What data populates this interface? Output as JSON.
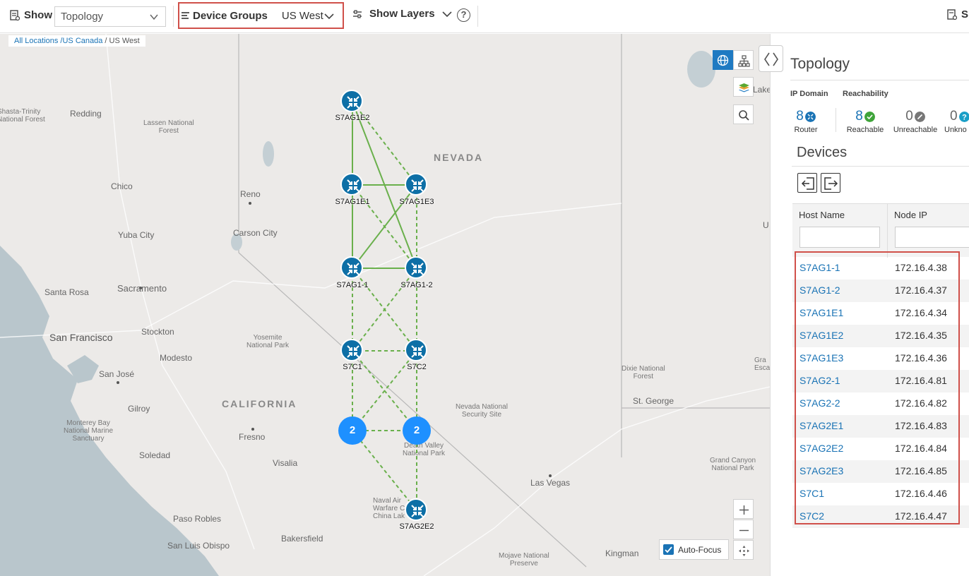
{
  "toolbar": {
    "show_label": "Show",
    "show_value": "Topology",
    "device_groups_label": "Device Groups",
    "device_groups_value": "US West",
    "show_layers_label": "Show Layers",
    "help_glyph": "?",
    "right_label": "S"
  },
  "map": {
    "breadcrumb": {
      "part1": "All Locations",
      "part2": " /US Canada",
      "part3": " / US West"
    },
    "places": {
      "shasta": "Shasta-Trinity\nNational Forest",
      "redding": "Redding",
      "lassen": "Lassen National\nForest",
      "chico": "Chico",
      "reno": "Reno",
      "carson": "Carson City",
      "yuba": "Yuba City",
      "sacramento": "Sacramento",
      "santa_rosa": "Santa Rosa",
      "stockton": "Stockton",
      "san_francisco": "San Francisco",
      "yosemite": "Yosemite\nNational Park",
      "modesto": "Modesto",
      "san_jose": "San José",
      "california": "CALIFORNIA",
      "gilroy": "Gilroy",
      "monterey": "Monterey Bay\nNational Marine\nSanctuary",
      "fresno": "Fresno",
      "soledad": "Soledad",
      "visalia": "Visalia",
      "paso_robles": "Paso Robles",
      "bakersfield": "Bakersfield",
      "san_luis": "San Luis Obispo",
      "nevada": "NEVADA",
      "nevada_security": "Nevada National\nSecurity Site",
      "death_valley": "Death Valley\nNational Park",
      "naval_air": "Naval Air\nWarfare Ce\nChina Lak",
      "las_vegas": "Las Vegas",
      "kingman": "Kingman",
      "mojave": "Mojave National\nPreserve",
      "dixie": "Dixie National\nForest",
      "st_george": "St. George",
      "grand_canyon": "Grand Canyon\nNational Park",
      "lake": "Lake",
      "u": "U",
      "gra": "Gra\nEsca"
    },
    "nodes": {
      "s7ag1e2": "S7AG1E2",
      "s7ag1e1": "S7AG1E1",
      "s7ag1e3": "S7AG1E3",
      "s7ag1_1": "S7AG1-1",
      "s7ag1_2": "S7AG1-2",
      "s7c1": "S7C1",
      "s7c2": "S7C2",
      "s7ag2e2": "S7AG2E2"
    },
    "clusters": {
      "left": "2",
      "right": "2"
    },
    "autofocus_label": "Auto-Focus",
    "autofocus_checked": true
  },
  "panel": {
    "title": "Topology",
    "ip_domain_label": "IP Domain",
    "reachability_label": "Reachability",
    "stats": [
      {
        "count": "8",
        "label": "Router",
        "icon": "router-icon"
      },
      {
        "count": "8",
        "label": "Reachable",
        "icon": "check-icon"
      },
      {
        "count": "0",
        "label": "Unreachable",
        "icon": "slash-icon"
      },
      {
        "count": "0",
        "label": "Unkno",
        "icon": "question-icon"
      }
    ],
    "devices_title": "Devices",
    "columns": {
      "host": "Host Name",
      "ip": "Node IP"
    },
    "rows": [
      {
        "host": "S7AG1-1",
        "ip": "172.16.4.38"
      },
      {
        "host": "S7AG1-2",
        "ip": "172.16.4.37"
      },
      {
        "host": "S7AG1E1",
        "ip": "172.16.4.34"
      },
      {
        "host": "S7AG1E2",
        "ip": "172.16.4.35"
      },
      {
        "host": "S7AG1E3",
        "ip": "172.16.4.36"
      },
      {
        "host": "S7AG2-1",
        "ip": "172.16.4.81"
      },
      {
        "host": "S7AG2-2",
        "ip": "172.16.4.82"
      },
      {
        "host": "S7AG2E1",
        "ip": "172.16.4.83"
      },
      {
        "host": "S7AG2E2",
        "ip": "172.16.4.84"
      },
      {
        "host": "S7AG2E3",
        "ip": "172.16.4.85"
      },
      {
        "host": "S7C1",
        "ip": "172.16.4.46"
      },
      {
        "host": "S7C2",
        "ip": "172.16.4.47"
      }
    ]
  },
  "colors": {
    "accent": "#1a73b5",
    "node": "#0d6fa6",
    "cluster": "#1e90ff",
    "link": "#6ab04c",
    "highlight": "#d0504a"
  }
}
